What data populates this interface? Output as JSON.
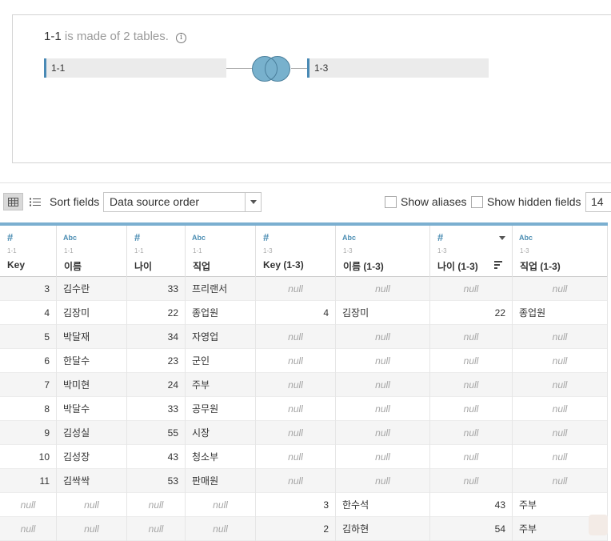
{
  "join": {
    "left_table": "1-1",
    "title_suffix": "is made of 2 tables.",
    "info_icon": "i",
    "right_table": "1-3"
  },
  "toolbar": {
    "sort_label": "Sort fields",
    "sort_value": "Data source order",
    "show_aliases": "Show aliases",
    "show_hidden": "Show hidden fields",
    "rows_value": "14"
  },
  "columns": [
    {
      "type": "#",
      "source": "1-1",
      "name": "Key",
      "align": "num"
    },
    {
      "type": "Abc",
      "source": "1-1",
      "name": "이름",
      "align": "txt"
    },
    {
      "type": "#",
      "source": "1-1",
      "name": "나이",
      "align": "num"
    },
    {
      "type": "Abc",
      "source": "1-1",
      "name": "직업",
      "align": "txt"
    },
    {
      "type": "#",
      "source": "1-3",
      "name": "Key (1-3)",
      "align": "num"
    },
    {
      "type": "Abc",
      "source": "1-3",
      "name": "이름 (1-3)",
      "align": "txt"
    },
    {
      "type": "#",
      "source": "1-3",
      "name": "나이 (1-3)",
      "align": "num"
    },
    {
      "type": "Abc",
      "source": "1-3",
      "name": "직업 (1-3)",
      "align": "txt"
    }
  ],
  "rows": [
    [
      "3",
      "김수란",
      "33",
      "프리랜서",
      null,
      null,
      null,
      null
    ],
    [
      "4",
      "김장미",
      "22",
      "종업원",
      "4",
      "김장미",
      "22",
      "종업원"
    ],
    [
      "5",
      "박달재",
      "34",
      "자영업",
      null,
      null,
      null,
      null
    ],
    [
      "6",
      "한달수",
      "23",
      "군인",
      null,
      null,
      null,
      null
    ],
    [
      "7",
      "박미현",
      "24",
      "주부",
      null,
      null,
      null,
      null
    ],
    [
      "8",
      "박달수",
      "33",
      "공무원",
      null,
      null,
      null,
      null
    ],
    [
      "9",
      "김성실",
      "55",
      "시장",
      null,
      null,
      null,
      null
    ],
    [
      "10",
      "김성장",
      "43",
      "청소부",
      null,
      null,
      null,
      null
    ],
    [
      "11",
      "김싹싹",
      "53",
      "판매원",
      null,
      null,
      null,
      null
    ],
    [
      null,
      null,
      null,
      null,
      "3",
      "한수석",
      "43",
      "주부"
    ],
    [
      null,
      null,
      null,
      null,
      "2",
      "김하현",
      "54",
      "주부"
    ]
  ],
  "null_text": "null"
}
